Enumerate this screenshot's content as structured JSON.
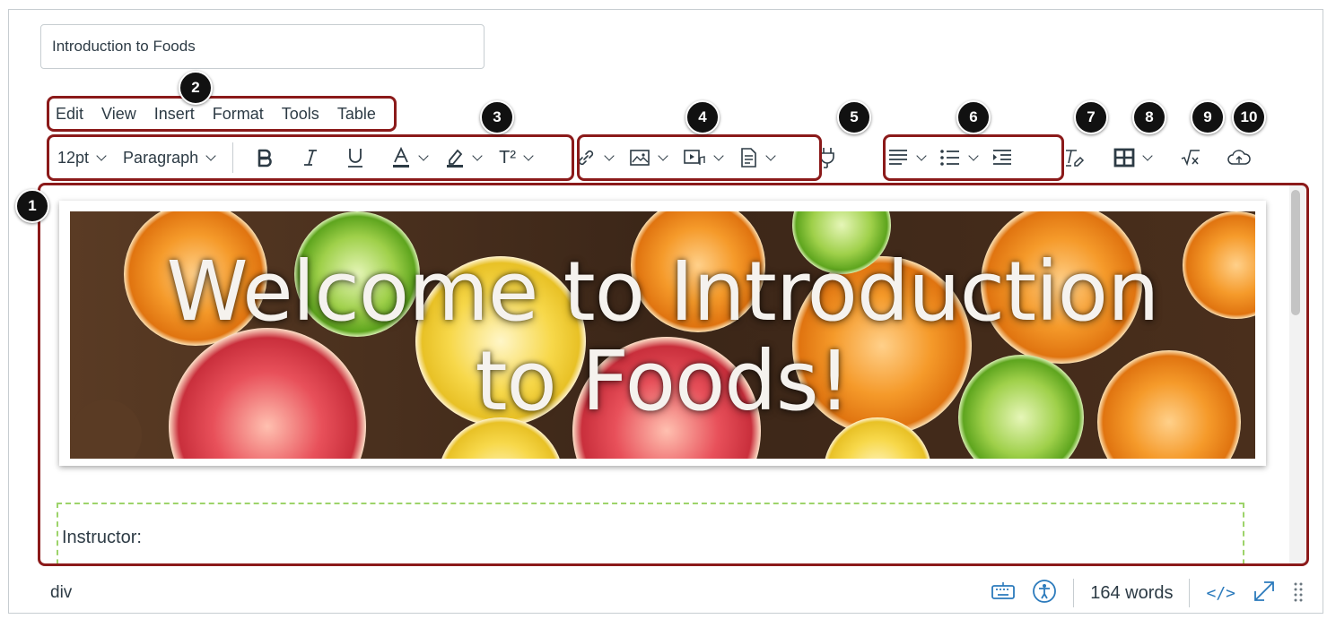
{
  "title_input": {
    "value": "Introduction to Foods"
  },
  "menubar": {
    "items": [
      "Edit",
      "View",
      "Insert",
      "Format",
      "Tools",
      "Table"
    ]
  },
  "toolbar": {
    "font_size": "12pt",
    "block_format": "Paragraph",
    "superscript_label": "T²"
  },
  "callouts": [
    "1",
    "2",
    "3",
    "4",
    "5",
    "6",
    "7",
    "8",
    "9",
    "10"
  ],
  "editor": {
    "banner_title_line1": "Welcome to Introduction",
    "banner_title_line2": "to Foods!",
    "instructor_label": "Instructor:"
  },
  "statusbar": {
    "path": "div",
    "word_count": "164 words",
    "html_toggle": "</>"
  },
  "colors": {
    "callout_outline": "#8b1a1a",
    "accent": "#2b7abc",
    "dashed_box": "#9dd36a"
  }
}
